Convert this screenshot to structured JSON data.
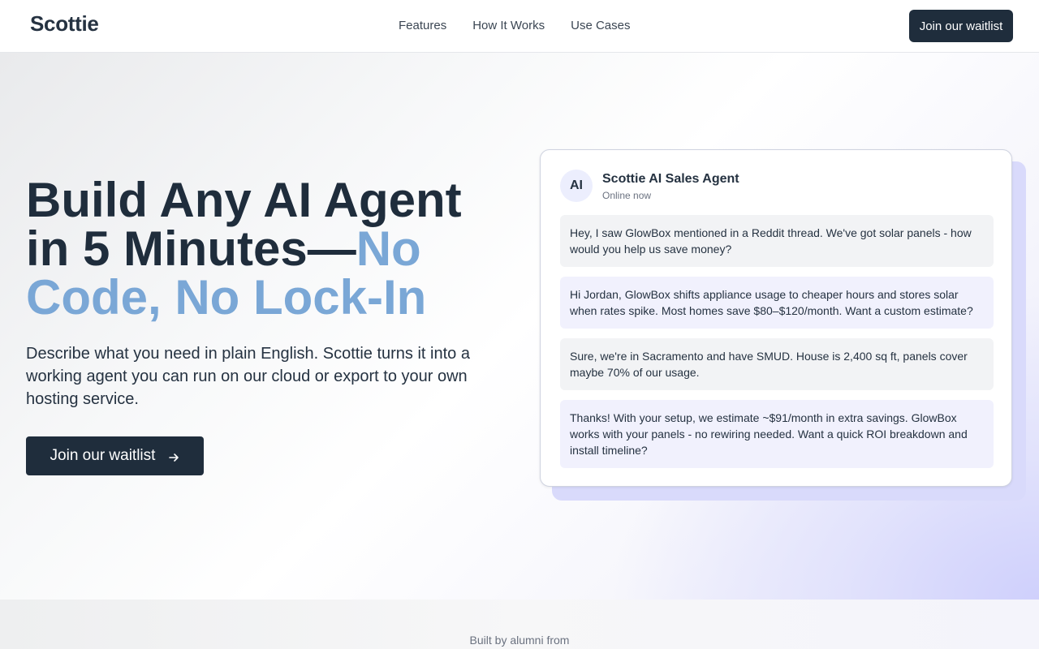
{
  "brand": {
    "logo_text": "Scottie"
  },
  "nav": {
    "links": [
      "Features",
      "How It Works",
      "Use Cases"
    ],
    "cta_label": "Join our waitlist"
  },
  "hero": {
    "headline_main": "Build Any AI Agent in 5 Minutes—",
    "headline_accent": "No Code, No Lock-In",
    "subhead": "Describe what you need in plain English. Scottie turns it into a working agent you can run on our cloud or export to your own hosting service.",
    "cta_label": "Join our waitlist",
    "cta_icon": "arrow-right-icon"
  },
  "chat": {
    "avatar_text": "AI",
    "agent_name": "Scottie AI Sales Agent",
    "agent_status": "Online now",
    "messages": [
      {
        "role": "user",
        "text": "Hey, I saw GlowBox mentioned in a Reddit thread. We've got solar panels - how would you help us save money?"
      },
      {
        "role": "agent",
        "text": "Hi Jordan, GlowBox shifts appliance usage to cheaper hours and stores solar when rates spike. Most homes save $80–$120/month. Want a custom estimate?"
      },
      {
        "role": "user",
        "text": "Sure, we're in Sacramento and have SMUD. House is 2,400 sq ft, panels cover maybe 70% of our usage."
      },
      {
        "role": "agent",
        "text": "Thanks! With your setup, we estimate ~$91/month in extra savings. GlowBox works with your panels - no rewiring needed. Want a quick ROI breakdown and install timeline?"
      }
    ]
  },
  "trust": {
    "label": "Built by alumni from"
  },
  "colors": {
    "primary_dark": "#1f2d3c",
    "accent_blue": "#7aa7d6",
    "agent_bubble": "#f1f1fd",
    "user_bubble": "#f2f3f5"
  }
}
